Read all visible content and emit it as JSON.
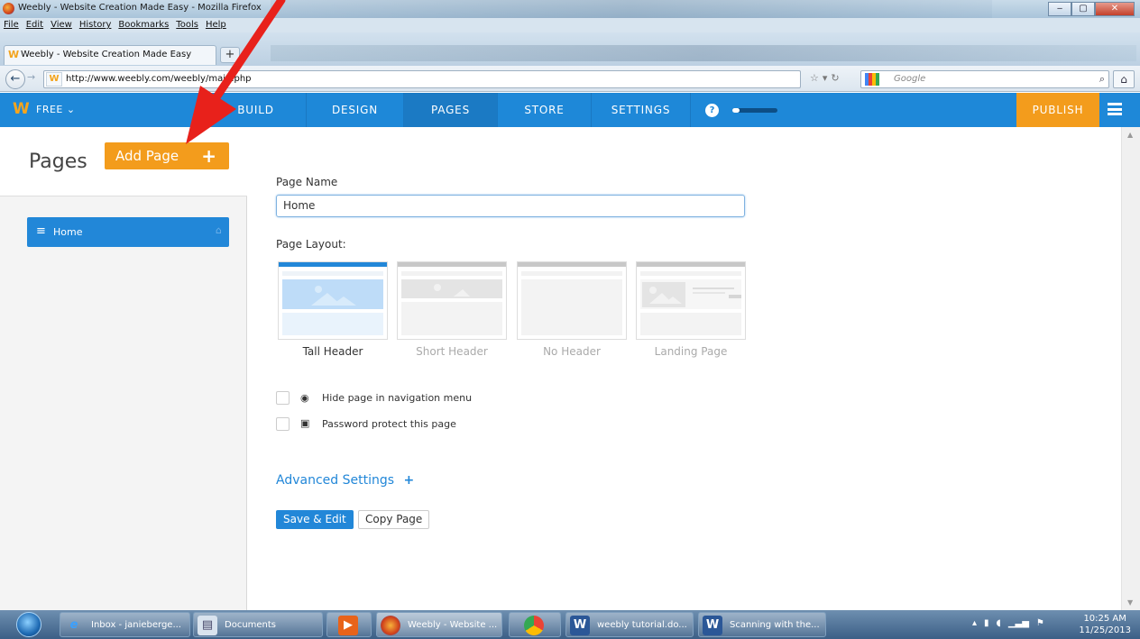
{
  "browser": {
    "window_title": "Weebly - Website Creation Made Easy - Mozilla Firefox",
    "menu": [
      "File",
      "Edit",
      "View",
      "History",
      "Bookmarks",
      "Tools",
      "Help"
    ],
    "tab_title": "Weebly - Website Creation Made Easy",
    "new_tab": "+",
    "url": "http://www.weebly.com/weebly/main.php",
    "search_placeholder": "Google"
  },
  "weebly_toolbar": {
    "plan": "FREE",
    "nav": [
      "BUILD",
      "DESIGN",
      "PAGES",
      "STORE",
      "SETTINGS"
    ],
    "active": "PAGES",
    "help": "?",
    "publish": "PUBLISH"
  },
  "sidebar": {
    "title": "Pages",
    "add_page": "Add Page",
    "pages": [
      {
        "label": "Home"
      }
    ]
  },
  "form": {
    "page_name_label": "Page Name",
    "page_name_value": "Home",
    "layout_label": "Page Layout:",
    "layouts": [
      "Tall Header",
      "Short Header",
      "No Header",
      "Landing Page"
    ],
    "selected_layout": "Tall Header",
    "options": [
      "Hide page in navigation menu",
      "Password protect this page"
    ],
    "advanced": "Advanced Settings",
    "advanced_plus": "+",
    "save": "Save & Edit",
    "copy": "Copy Page"
  },
  "taskbar": {
    "items": [
      "Inbox - janieberge...",
      "Documents",
      "",
      "Weebly - Website ...",
      "",
      "weebly tutorial.do...",
      "Scanning with the..."
    ],
    "time": "10:25 AM",
    "date": "11/25/2013"
  },
  "colors": {
    "accent": "#2287d8",
    "orange": "#f39c1c",
    "arrow": "#e8211b"
  }
}
